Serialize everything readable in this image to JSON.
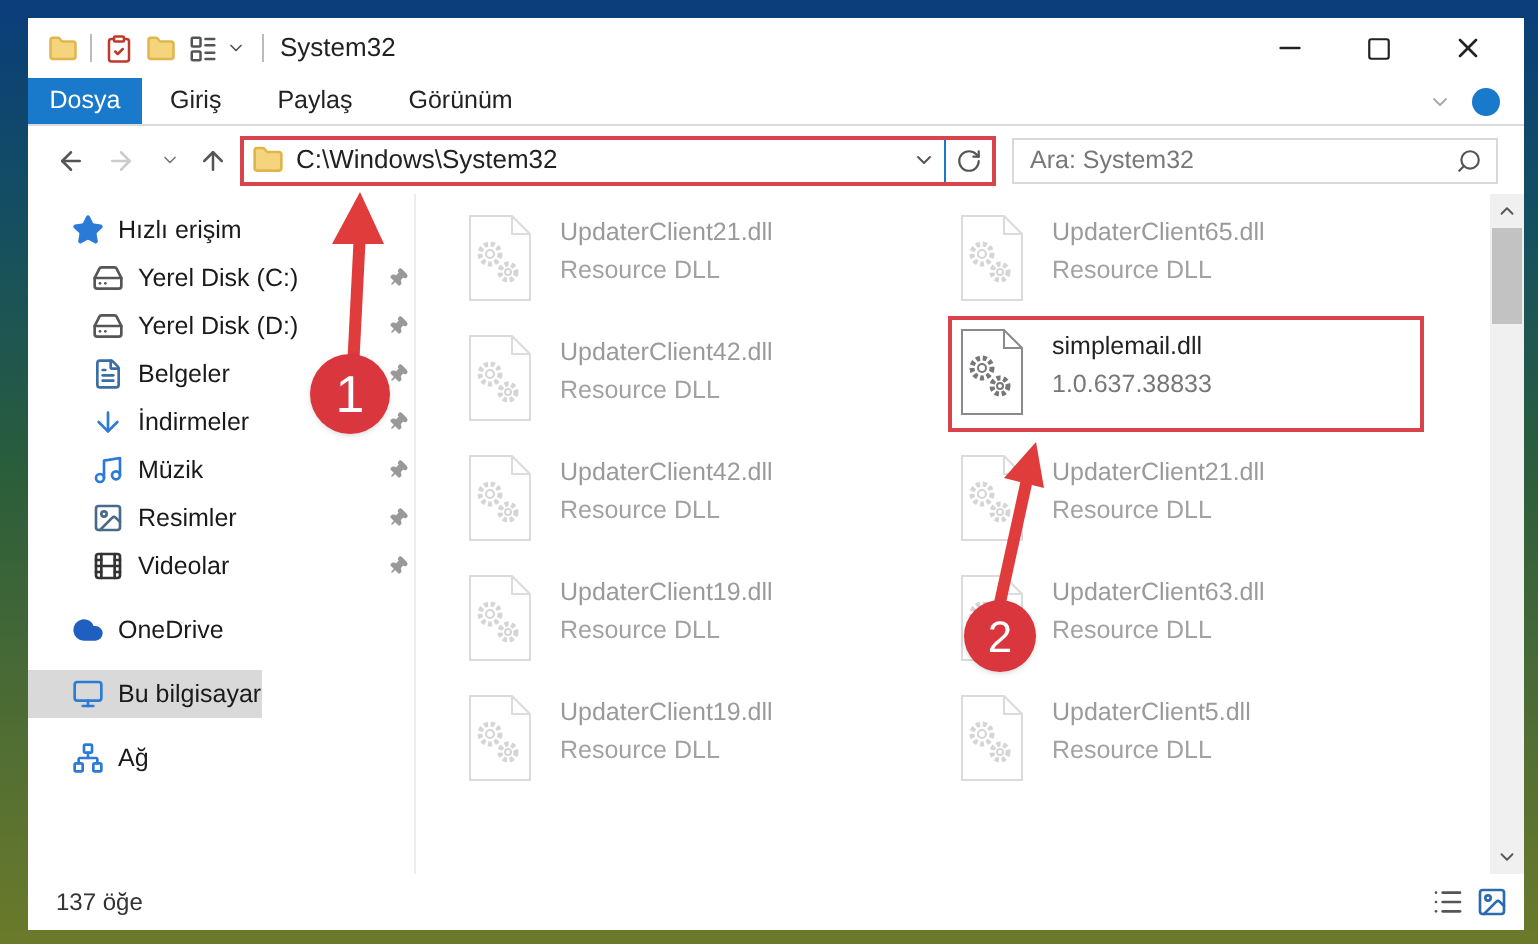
{
  "window": {
    "title": "System32"
  },
  "ribbon_tabs": [
    {
      "label": "Dosya",
      "selected": true
    },
    {
      "label": "Giriş",
      "selected": false
    },
    {
      "label": "Paylaş",
      "selected": false
    },
    {
      "label": "Görünüm",
      "selected": false
    }
  ],
  "address_bar": {
    "path": "C:\\Windows\\System32",
    "highlighted": true
  },
  "search": {
    "placeholder": "Ara: System32"
  },
  "sidebar": {
    "items": [
      {
        "label": "Hızlı erişim",
        "kind": "quick",
        "selected": false,
        "children": [
          {
            "label": "Yerel Disk (C:)",
            "kind": "drive-c",
            "selected": false,
            "pinned": true
          },
          {
            "label": "Yerel Disk (D:)",
            "kind": "drive",
            "selected": false,
            "pinned": true
          },
          {
            "label": "Belgeler",
            "kind": "documents",
            "selected": false,
            "pinned": true
          },
          {
            "label": "İndirmeler",
            "kind": "downloads",
            "selected": false,
            "pinned": true
          },
          {
            "label": "Müzik",
            "kind": "music",
            "selected": false,
            "pinned": true
          },
          {
            "label": "Resimler",
            "kind": "pictures",
            "selected": false,
            "pinned": true
          },
          {
            "label": "Videolar",
            "kind": "videos",
            "selected": false,
            "pinned": true
          }
        ]
      },
      {
        "label": "OneDrive",
        "kind": "cloud",
        "selected": false
      },
      {
        "label": "Bu bilgisayar",
        "kind": "pc",
        "selected": true
      },
      {
        "label": "Ağ",
        "kind": "network",
        "selected": false
      }
    ]
  },
  "files": [
    {
      "name": "UpdaterClient21.dll",
      "detail": "Resource DLL",
      "dimmed": true,
      "highlighted": false
    },
    {
      "name": "UpdaterClient65.dll",
      "detail": "Resource DLL",
      "dimmed": true,
      "highlighted": false
    },
    {
      "name": "UpdaterClient42.dll",
      "detail": "Resource DLL",
      "dimmed": true,
      "highlighted": false
    },
    {
      "name": "simplemail.dll",
      "detail": "1.0.637.38833",
      "dimmed": false,
      "highlighted": true
    },
    {
      "name": "UpdaterClient42.dll",
      "detail": "Resource DLL",
      "dimmed": true,
      "highlighted": false
    },
    {
      "name": "UpdaterClient21.dll",
      "detail": "Resource DLL",
      "dimmed": true,
      "highlighted": false
    },
    {
      "name": "UpdaterClient19.dll",
      "detail": "Resource DLL",
      "dimmed": true,
      "highlighted": false
    },
    {
      "name": "UpdaterClient63.dll",
      "detail": "Resource DLL",
      "dimmed": true,
      "highlighted": false
    },
    {
      "name": "UpdaterClient19.dll",
      "detail": "Resource DLL",
      "dimmed": true,
      "highlighted": false
    },
    {
      "name": "UpdaterClient5.dll",
      "detail": "Resource DLL",
      "dimmed": true,
      "highlighted": false
    }
  ],
  "status_bar": {
    "item_count": "137 öğe"
  },
  "annotations": [
    {
      "label": "1"
    },
    {
      "label": "2"
    }
  ]
}
